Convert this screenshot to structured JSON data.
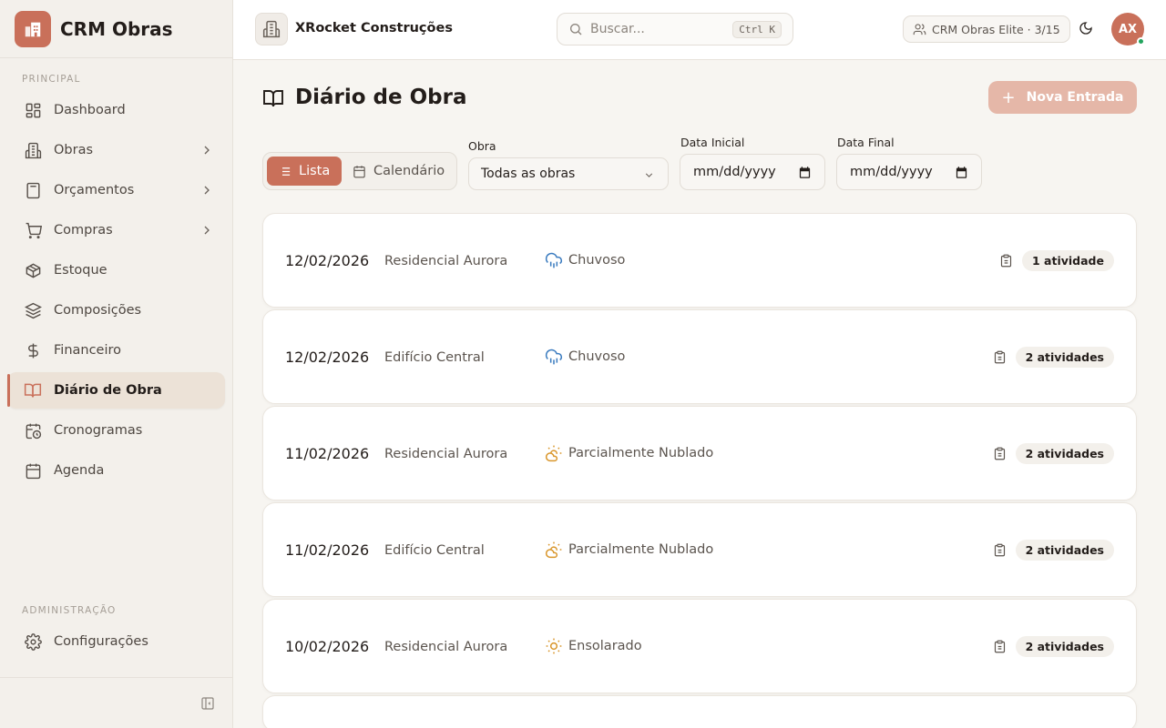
{
  "app": {
    "name": "CRM Obras",
    "company": "XRocket Construções"
  },
  "sidebar": {
    "section_principal": "PRINCIPAL",
    "section_admin": "ADMINISTRAÇÃO",
    "items": [
      {
        "label": "Dashboard",
        "icon": "dashboard-icon"
      },
      {
        "label": "Obras",
        "icon": "building-icon",
        "has_submenu": true
      },
      {
        "label": "Orçamentos",
        "icon": "calculator-icon",
        "has_submenu": true
      },
      {
        "label": "Compras",
        "icon": "cart-icon",
        "has_submenu": true
      },
      {
        "label": "Estoque",
        "icon": "box-icon"
      },
      {
        "label": "Composições",
        "icon": "layers-icon"
      },
      {
        "label": "Financeiro",
        "icon": "dollar-icon"
      },
      {
        "label": "Diário de Obra",
        "icon": "book-icon",
        "active": true
      },
      {
        "label": "Cronogramas",
        "icon": "calendar-clock-icon"
      },
      {
        "label": "Agenda",
        "icon": "calendar-icon"
      }
    ],
    "admin_items": [
      {
        "label": "Configurações",
        "icon": "gear-icon"
      }
    ]
  },
  "header": {
    "search_placeholder": "Buscar...",
    "search_shortcut": "Ctrl K",
    "plan_label": "CRM Obras Elite · 3/15",
    "avatar_initials": "AX"
  },
  "page": {
    "title": "Diário de Obra",
    "new_button": "Nova Entrada",
    "view_list": "Lista",
    "view_calendar": "Calendário",
    "filter_obra_label": "Obra",
    "filter_obra_value": "Todas as obras",
    "date_start_label": "Data Inicial",
    "date_start_value": "mm/dd/yyyy",
    "date_end_label": "Data Final",
    "date_end_value": "mm/dd/yyyy"
  },
  "entries": [
    {
      "date": "12/02/2026",
      "site": "Residencial Aurora",
      "weather": "Chuvoso",
      "weather_icon": "rain-cloud-icon",
      "activities": "1 atividade"
    },
    {
      "date": "12/02/2026",
      "site": "Edifício Central",
      "weather": "Chuvoso",
      "weather_icon": "rain-cloud-icon",
      "activities": "2 atividades"
    },
    {
      "date": "11/02/2026",
      "site": "Residencial Aurora",
      "weather": "Parcialmente Nublado",
      "weather_icon": "partly-cloudy-icon",
      "activities": "2 atividades"
    },
    {
      "date": "11/02/2026",
      "site": "Edifício Central",
      "weather": "Parcialmente Nublado",
      "weather_icon": "partly-cloudy-icon",
      "activities": "2 atividades"
    },
    {
      "date": "10/02/2026",
      "site": "Residencial Aurora",
      "weather": "Ensolarado",
      "weather_icon": "sun-icon",
      "activities": "2 atividades"
    }
  ],
  "colors": {
    "accent": "#c9705a",
    "accent_light": "#e5b7a8",
    "rain": "#3a7bbf",
    "sun": "#d9962b",
    "online": "#22a45d"
  }
}
